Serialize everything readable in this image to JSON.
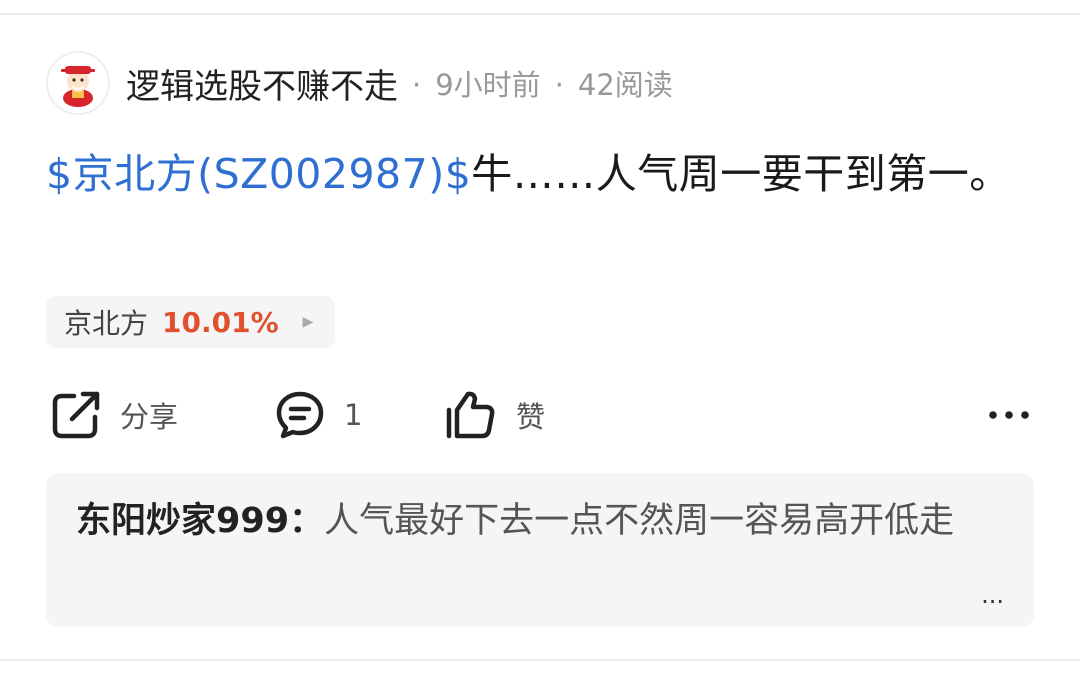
{
  "post": {
    "author": "逻辑选股不赚不走",
    "time": "9小时前",
    "reads": "42阅读",
    "meta_separator": "·",
    "stock_mention": "$京北方(SZ002987)$",
    "text": "牛……人气周一要干到第一。"
  },
  "stock_chip": {
    "name": "京北方",
    "change": "10.01%",
    "change_color": "#e0522e"
  },
  "actions": {
    "share_label": "分享",
    "comment_count": "1",
    "like_label": "赞"
  },
  "comment": {
    "author": "东阳炒家999：",
    "text": "人气最好下去一点不然周一容易高开低走",
    "more": "..."
  },
  "colors": {
    "link": "#2e6fd1",
    "up": "#e0522e"
  },
  "icons": [
    "avatar-icon",
    "share-icon",
    "comment-icon",
    "thumbs-up-icon",
    "more-icon",
    "chevron-right-icon"
  ]
}
